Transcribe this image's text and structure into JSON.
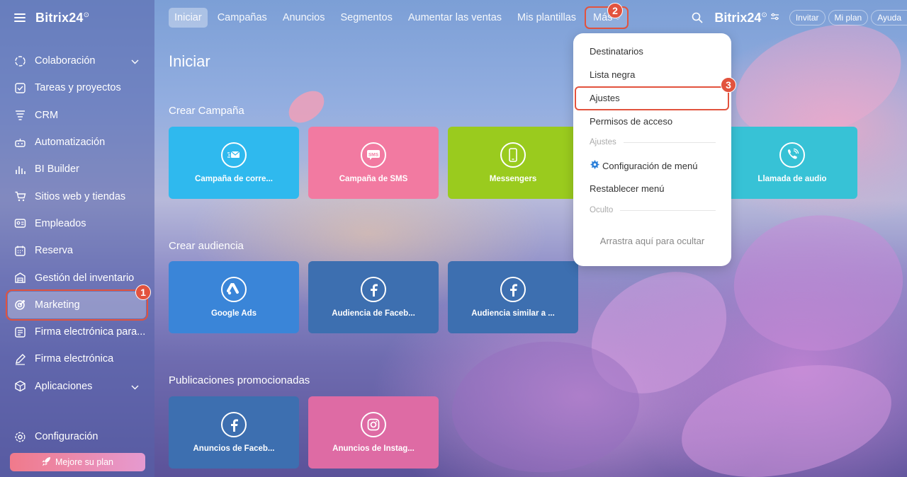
{
  "brand": {
    "name": "Bitrix24",
    "mark": "⊙"
  },
  "sidebar": {
    "items": [
      {
        "label": "Colaboración",
        "icon": "collaboration-icon",
        "has_chevron": true
      },
      {
        "label": "Tareas y proyectos",
        "icon": "tasks-icon"
      },
      {
        "label": "CRM",
        "icon": "crm-icon"
      },
      {
        "label": "Automatización",
        "icon": "automation-icon"
      },
      {
        "label": "BI Builder",
        "icon": "bi-builder-icon"
      },
      {
        "label": "Sitios web y tiendas",
        "icon": "cart-icon"
      },
      {
        "label": "Empleados",
        "icon": "employees-icon"
      },
      {
        "label": "Reserva",
        "icon": "calendar-icon"
      },
      {
        "label": "Gestión del inventario",
        "icon": "inventory-icon"
      },
      {
        "label": "Marketing",
        "icon": "marketing-icon",
        "active": true
      },
      {
        "label": "Firma electrónica para...",
        "icon": "esign-icon"
      },
      {
        "label": "Firma electrónica",
        "icon": "pen-icon"
      },
      {
        "label": "Aplicaciones",
        "icon": "apps-icon",
        "has_chevron": true
      }
    ],
    "config_label": "Configuración",
    "upgrade_label": "Mejore su plan"
  },
  "topnav": {
    "tabs": [
      "Iniciar",
      "Campañas",
      "Anuncios",
      "Segmentos",
      "Aumentar las ventas",
      "Mis plantillas"
    ],
    "more_label": "Más",
    "invite_label": "Invitar",
    "plan_label": "Mi plan",
    "help_label": "Ayuda"
  },
  "annotations": {
    "step1": "1",
    "step2": "2",
    "step3": "3"
  },
  "main": {
    "title": "Iniciar",
    "sections": [
      {
        "title": "Crear Campaña",
        "tiles": [
          {
            "label": "Campaña de corre...",
            "icon": "email-icon",
            "color": "#2fb9ee"
          },
          {
            "label": "Campaña de SMS",
            "icon": "sms-icon",
            "color": "#f27aa1"
          },
          {
            "label": "Messengers",
            "icon": "phone-icon",
            "color": "#9acb1e"
          },
          {
            "label": "Llamada de audio",
            "icon": "audio-call-icon",
            "color": "#37c2d6"
          }
        ]
      },
      {
        "title": "Crear audiencia",
        "tiles": [
          {
            "label": "Google Ads",
            "icon": "google-ads-icon",
            "color": "#3a85d8"
          },
          {
            "label": "Audiencia de Faceb...",
            "icon": "facebook-icon",
            "color": "#3d6fb0"
          },
          {
            "label": "Audiencia similar a ...",
            "icon": "facebook-icon",
            "color": "#3d6fb0"
          }
        ]
      },
      {
        "title": "Publicaciones promocionadas",
        "tiles": [
          {
            "label": "Anuncios de Faceb...",
            "icon": "facebook-icon",
            "color": "#3d6fb0"
          },
          {
            "label": "Anuncios de Instag...",
            "icon": "instagram-icon",
            "color": "#de6ba4"
          }
        ]
      }
    ]
  },
  "dropdown": {
    "items": [
      "Destinatarios",
      "Lista negra",
      "Ajustes",
      "Permisos de acceso"
    ],
    "group_settings": "Ajustes",
    "menu_config": "Configuración de menú",
    "reset_menu": "Restablecer menú",
    "group_hidden": "Oculto",
    "drop_hint": "Arrastra aquí para ocultar"
  },
  "colors": {
    "accent_red": "#e2533e"
  }
}
